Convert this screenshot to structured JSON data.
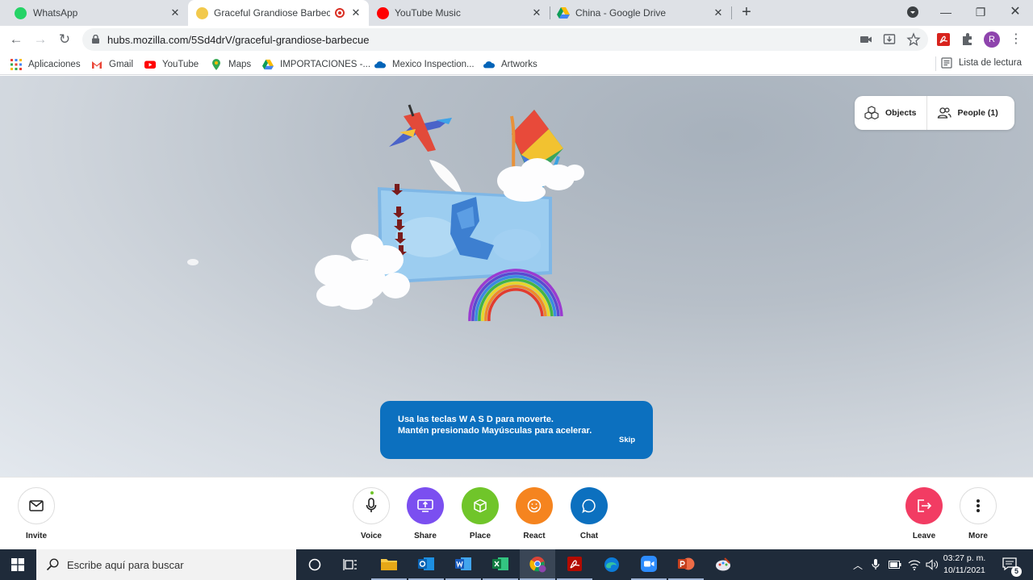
{
  "browser": {
    "tabs": [
      {
        "title": "WhatsApp"
      },
      {
        "title": "Graceful Grandiose Barbecue"
      },
      {
        "title": "YouTube Music"
      },
      {
        "title": "China - Google Drive"
      }
    ],
    "url": "hubs.mozilla.com/5Sd4drV/graceful-grandiose-barbecue",
    "profile_initial": "R",
    "bookmarks": [
      "Aplicaciones",
      "Gmail",
      "YouTube",
      "Maps",
      "IMPORTACIONES -...",
      "Mexico Inspection...",
      "Artworks"
    ],
    "reading_list": "Lista de lectura"
  },
  "scene": {
    "objects_label": "Objects",
    "people_label": "People (1)",
    "tip_message": "Usa las teclas W A S D para moverte.\nMantén presionado Mayúsculas para acelerar.",
    "skip_label": "Skip"
  },
  "toolbar": {
    "invite": "Invite",
    "voice": "Voice",
    "share": "Share",
    "place": "Place",
    "react": "React",
    "chat": "Chat",
    "leave": "Leave",
    "more": "More"
  },
  "colors": {
    "share": "#7b4ff0",
    "place": "#70c52a",
    "react": "#f5841f",
    "chat": "#0c70bf",
    "leave": "#f23c63",
    "tip_bg": "#0c70bf"
  },
  "taskbar": {
    "search_placeholder": "Escribe aquí para buscar",
    "time": "03:27 p. m.",
    "date": "10/11/2021",
    "notifications": "5"
  }
}
